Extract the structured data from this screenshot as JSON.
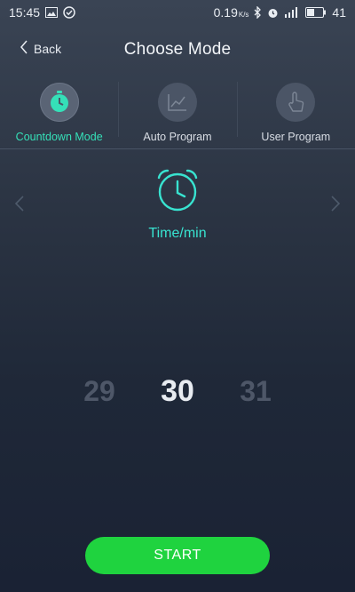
{
  "status_bar": {
    "time": "15:45",
    "speed": "0.19",
    "speed_unit": "K/s",
    "battery": "41",
    "icons": [
      "gallery-icon",
      "check-circle-icon",
      "bluetooth-icon",
      "alarm-icon",
      "signal-icon",
      "battery-icon"
    ]
  },
  "header": {
    "back_label": "Back",
    "title": "Choose Mode"
  },
  "tabs": [
    {
      "label": "Countdown Mode",
      "icon": "stopwatch-icon",
      "active": true
    },
    {
      "label": "Auto Program",
      "icon": "chart-icon",
      "active": false
    },
    {
      "label": "User Program",
      "icon": "hand-pointer-icon",
      "active": false
    }
  ],
  "mode": {
    "icon": "alarm-clock-icon",
    "label": "Time/min"
  },
  "picker": {
    "prev": "29",
    "selected": "30",
    "next": "31"
  },
  "start_label": "START",
  "colors": {
    "accent": "#35e0b8",
    "start": "#1fd33f",
    "background": "#2b3443"
  }
}
